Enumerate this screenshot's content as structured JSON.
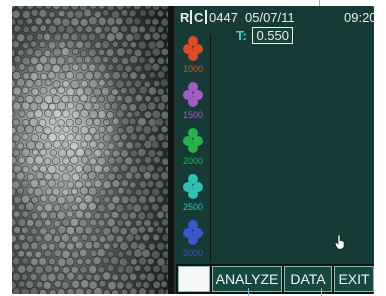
{
  "header": {
    "mode_r": "R",
    "mode_c": "C",
    "image_number": "0447",
    "date": "05/07/11",
    "time": "09:20"
  },
  "threshold": {
    "label": "T:",
    "value": "0.550"
  },
  "density_scale": [
    {
      "label": "1000",
      "color": "#e04a25"
    },
    {
      "label": "1500",
      "color": "#a55cc0"
    },
    {
      "label": "2000",
      "color": "#27b34a"
    },
    {
      "label": "2500",
      "color": "#2ec3b0"
    },
    {
      "label": "3000",
      "color": "#3b57c9"
    }
  ],
  "menu": {
    "blank": "",
    "analyze": "ANALYZE",
    "data": "DATA",
    "exit": "EXIT"
  },
  "icons": {
    "density_marker": "cell-cluster-icon",
    "cursor": "hand-pointer-icon"
  },
  "colors": {
    "display_bg": "#163a36",
    "threshold_label": "#35d7c7",
    "text": "#e6eeee"
  }
}
